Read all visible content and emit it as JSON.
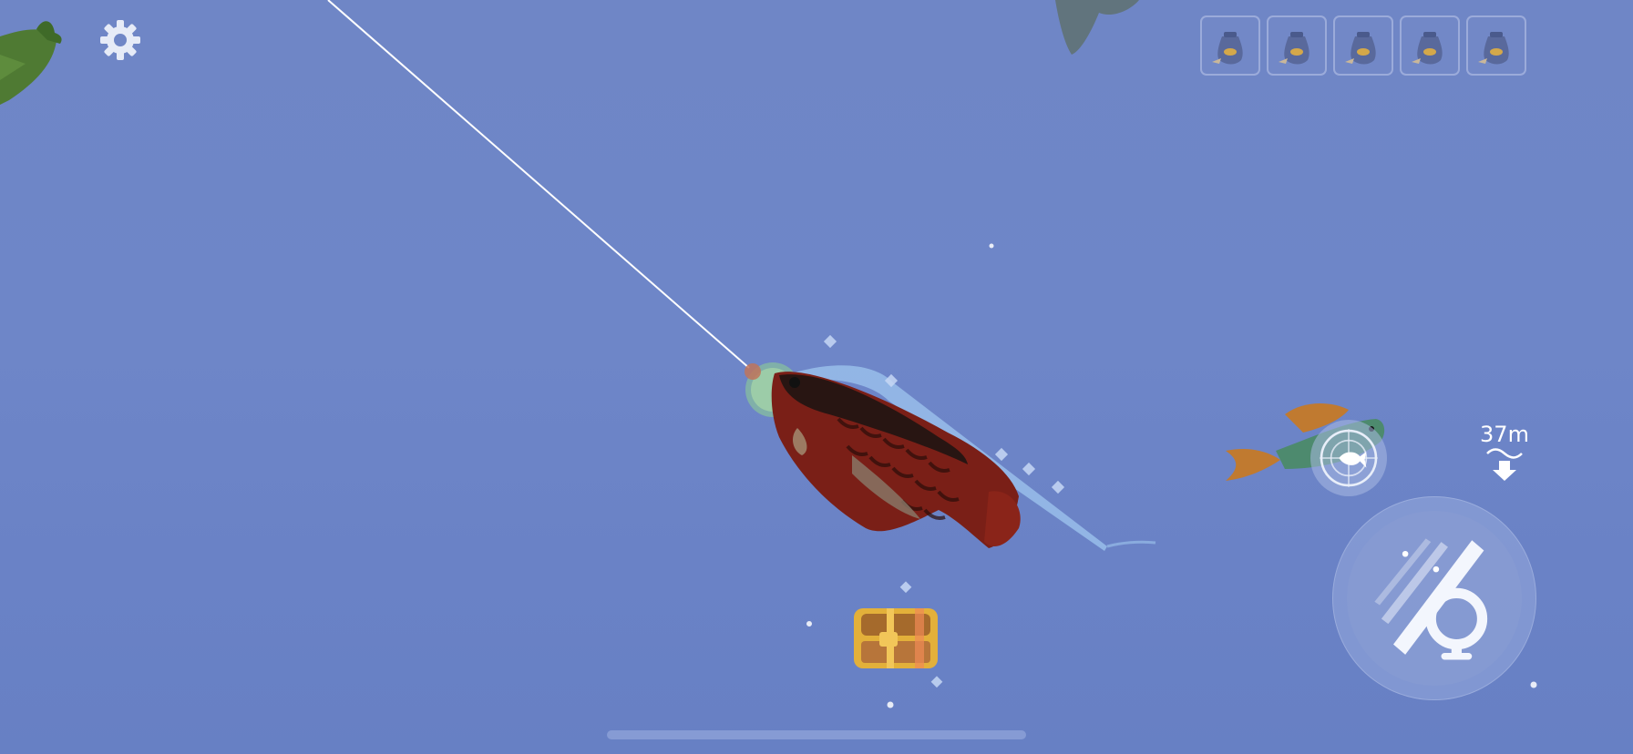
{
  "hud": {
    "depth_value": "37m",
    "settings_icon": "gear-icon",
    "inventory_slots": [
      {
        "icon": "bait-bag-icon"
      },
      {
        "icon": "bait-bag-icon"
      },
      {
        "icon": "bait-bag-icon"
      },
      {
        "icon": "bait-bag-icon"
      },
      {
        "icon": "bait-bag-icon"
      }
    ],
    "fish_radar_icon": "fish-target-icon",
    "reel_icon": "fishing-reel-icon"
  },
  "scene": {
    "hooked_fish": "red-arowana",
    "other_fish": "green-goldfin-fish",
    "treasure": "treasure-chest"
  },
  "colors": {
    "water": "#6f86c6",
    "hooked_fish": "#7a1f17",
    "chest_gold": "#e3b03a"
  }
}
